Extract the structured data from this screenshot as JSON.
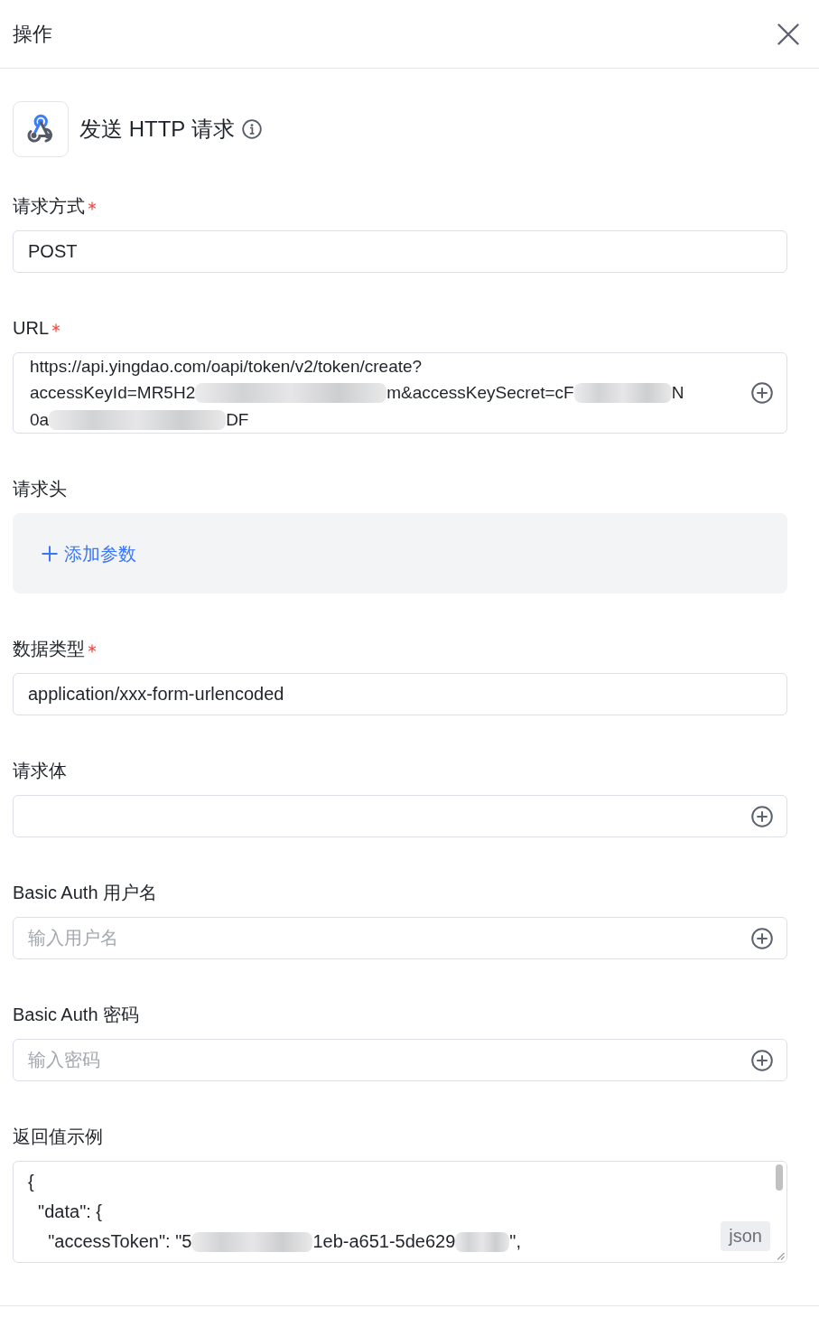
{
  "header": {
    "title": "操作"
  },
  "node": {
    "title": "发送 HTTP 请求"
  },
  "fields": [
    {
      "kind": "choice",
      "label": "请求方式",
      "required": true,
      "value": "POST"
    },
    {
      "kind": "variable",
      "label": "URL",
      "required": true,
      "lines": [
        [
          "https://api.yingdao.com/oapi/token/v2/token/create?"
        ],
        [
          "accessKeyId=MR5H2",
          "m&accessKeySecret=cF",
          "N"
        ],
        [
          "0a",
          "DF"
        ]
      ]
    },
    {
      "kind": "params",
      "label": "请求头",
      "required": false,
      "add_label": "添加参数"
    },
    {
      "kind": "choice",
      "label": "数据类型",
      "required": true,
      "value": "application/xxx-form-urlencoded"
    },
    {
      "kind": "variable",
      "label": "请求体",
      "required": false
    },
    {
      "kind": "variable",
      "label": "Basic Auth 用户名",
      "required": false,
      "placeholder": "输入用户名"
    },
    {
      "kind": "variable",
      "label": "Basic Auth 密码",
      "required": false,
      "placeholder": "输入密码"
    },
    {
      "kind": "code",
      "label": "返回值示例",
      "required": false,
      "lines": [
        [
          "{"
        ],
        [
          "  \"data\": {"
        ],
        [
          "    \"accessToken\": \"5",
          "1eb-a651-5de629",
          "\","
        ]
      ],
      "language": "json"
    }
  ]
}
